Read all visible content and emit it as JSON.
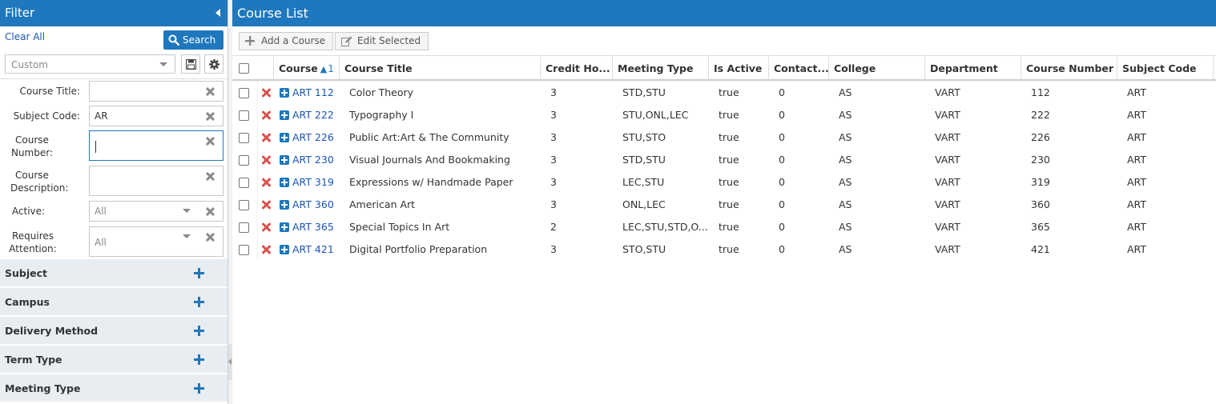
{
  "filter": {
    "title": "Filter",
    "clear_all": "Clear All",
    "search_label": "Search",
    "preset": "Custom",
    "fields": [
      {
        "label": "Course Title:",
        "value": ""
      },
      {
        "label": "Subject Code:",
        "value": "AR"
      },
      {
        "label": "Course Number:",
        "value": ""
      },
      {
        "label": "Course Description:",
        "value": ""
      },
      {
        "label": "Active:",
        "value": "All"
      },
      {
        "label": "Requires Attention:",
        "value": "All"
      }
    ],
    "sections": [
      "Subject",
      "Campus",
      "Delivery Method",
      "Term Type",
      "Meeting Type"
    ]
  },
  "course_list": {
    "title": "Course List",
    "toolbar": {
      "add_label": "Add a Course",
      "edit_label": "Edit Selected"
    },
    "columns": [
      "Course",
      "Course Title",
      "Credit Ho...",
      "Meeting Type",
      "Is Active",
      "Contact...",
      "College",
      "Department",
      "Course Number",
      "Subject Code"
    ],
    "sort_indicator": "1",
    "rows": [
      {
        "course": "ART 112",
        "title": "Color Theory",
        "credit": "3",
        "meeting": "STD,STU",
        "active": "true",
        "contact": "0",
        "college": "AS",
        "department": "VART",
        "number": "112",
        "subject": "ART"
      },
      {
        "course": "ART 222",
        "title": "Typography I",
        "credit": "3",
        "meeting": "STU,ONL,LEC",
        "active": "true",
        "contact": "0",
        "college": "AS",
        "department": "VART",
        "number": "222",
        "subject": "ART"
      },
      {
        "course": "ART 226",
        "title": "Public Art:Art & The Community",
        "credit": "3",
        "meeting": "STU,STO",
        "active": "true",
        "contact": "0",
        "college": "AS",
        "department": "VART",
        "number": "226",
        "subject": "ART"
      },
      {
        "course": "ART 230",
        "title": "Visual Journals And Bookmaking",
        "credit": "3",
        "meeting": "STD,STU",
        "active": "true",
        "contact": "0",
        "college": "AS",
        "department": "VART",
        "number": "230",
        "subject": "ART"
      },
      {
        "course": "ART 319",
        "title": "Expressions w/ Handmade Paper",
        "credit": "3",
        "meeting": "LEC,STU",
        "active": "true",
        "contact": "0",
        "college": "AS",
        "department": "VART",
        "number": "319",
        "subject": "ART"
      },
      {
        "course": "ART 360",
        "title": "American Art",
        "credit": "3",
        "meeting": "ONL,LEC",
        "active": "true",
        "contact": "0",
        "college": "AS",
        "department": "VART",
        "number": "360",
        "subject": "ART"
      },
      {
        "course": "ART 365",
        "title": "Special Topics In Art",
        "credit": "2",
        "meeting": "LEC,STU,STD,O...",
        "active": "true",
        "contact": "0",
        "college": "AS",
        "department": "VART",
        "number": "365",
        "subject": "ART"
      },
      {
        "course": "ART 421",
        "title": "Digital Portfolio Preparation",
        "credit": "3",
        "meeting": "STO,STU",
        "active": "true",
        "contact": "0",
        "college": "AS",
        "department": "VART",
        "number": "421",
        "subject": "ART"
      }
    ]
  }
}
